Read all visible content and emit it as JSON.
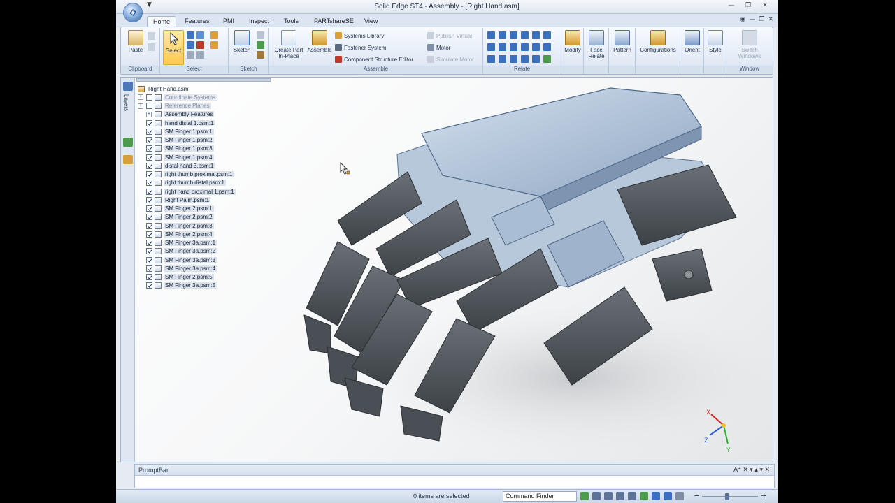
{
  "window": {
    "title": "Solid Edge ST4 - Assembly - [Right Hand.asm]",
    "qat": "▼",
    "controls": {
      "minimize": "—",
      "restore": "❐",
      "close": "✕"
    }
  },
  "tabs": [
    {
      "label": "Home"
    },
    {
      "label": "Features"
    },
    {
      "label": "PMI"
    },
    {
      "label": "Inspect"
    },
    {
      "label": "Tools"
    },
    {
      "label": "PARTshareSE"
    },
    {
      "label": "View"
    }
  ],
  "ribbon": {
    "clipboard": {
      "label": "Clipboard",
      "paste": "Paste"
    },
    "select": {
      "label": "Select",
      "select_button": "Select"
    },
    "sketch": {
      "label": "Sketch",
      "sketch_button": "Sketch"
    },
    "assemble": {
      "label": "Assemble",
      "create_part_line1": "Create Part",
      "create_part_line2": "In-Place",
      "assemble_button": "Assemble",
      "systems_library": "Systems Library",
      "fastener_system": "Fastener System",
      "component_structure_editor": "Component Structure Editor",
      "publish_virtual": "Publish Virtual",
      "motor": "Motor",
      "simulate_motor": "Simulate Motor"
    },
    "relate": {
      "label": "Relate"
    },
    "modify": "Modify",
    "face_relate_line1": "Face",
    "face_relate_line2": "Relate",
    "pattern": "Pattern",
    "configurations": "Configurations",
    "orient": "Orient",
    "style": "Style",
    "window": {
      "label": "Window",
      "switch_line1": "Switch",
      "switch_line2": "Windows"
    }
  },
  "sidebar": {
    "layers_tab": "Layers"
  },
  "tree": {
    "root": "Right Hand.asm",
    "items": [
      {
        "label": "Coordinate Systems",
        "type": "folder",
        "checked": false,
        "muted": true
      },
      {
        "label": "Reference Planes",
        "type": "folder",
        "checked": false,
        "muted": true
      },
      {
        "label": "Assembly Features",
        "type": "feature",
        "checked": null,
        "muted": false
      },
      {
        "label": "hand distal 1.psm:1",
        "checked": true
      },
      {
        "label": "SM Finger 1.psm:1",
        "checked": true
      },
      {
        "label": "SM Finger 1.psm:2",
        "checked": true
      },
      {
        "label": "SM Finger 1.psm:3",
        "checked": true
      },
      {
        "label": "SM Finger 1.psm:4",
        "checked": true
      },
      {
        "label": "distal hand 3.psm:1",
        "checked": true
      },
      {
        "label": "right thumb proximal.psm:1",
        "checked": true
      },
      {
        "label": "right thumb distal.psm:1",
        "checked": true
      },
      {
        "label": "right hand proximal 1.psm:1",
        "checked": true
      },
      {
        "label": "Right Palm.psm:1",
        "checked": true
      },
      {
        "label": "SM Finger 2.psm:1",
        "checked": true
      },
      {
        "label": "SM Finger 2.psm:2",
        "checked": true
      },
      {
        "label": "SM Finger 2.psm:3",
        "checked": true
      },
      {
        "label": "SM Finger 2.psm:4",
        "checked": true
      },
      {
        "label": "SM Finger 3a.psm:1",
        "checked": true
      },
      {
        "label": "SM Finger 3a.psm:2",
        "checked": true
      },
      {
        "label": "SM Finger 3a.psm:3",
        "checked": true
      },
      {
        "label": "SM Finger 3a.psm:4",
        "checked": true
      },
      {
        "label": "SM Finger 2.psm:5",
        "checked": true
      },
      {
        "label": "SM Finger 3a.psm:5",
        "checked": true
      }
    ]
  },
  "triad": {
    "x": "X",
    "y": "Y",
    "z": "Z"
  },
  "promptbar": {
    "title": "PromptBar",
    "controls": "A⁺ ✕ ▾ ▴ ▾ ✕"
  },
  "status": {
    "selection": "0 items are selected",
    "command_finder": "Command Finder"
  },
  "colors": {
    "palm_plate": "#a9bdd4",
    "finger_segment": "#555a60",
    "ribbon_select": "#ffc94d"
  }
}
